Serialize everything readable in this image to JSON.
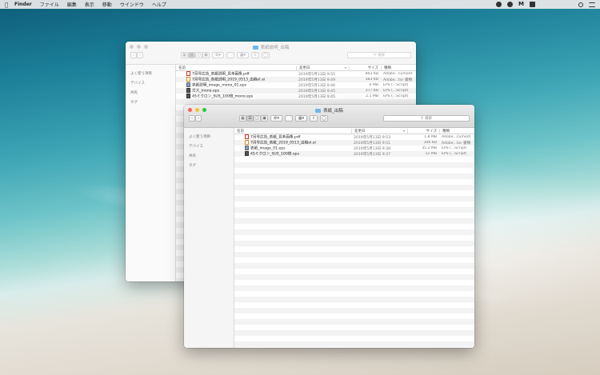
{
  "menubar": {
    "app": "Finder",
    "items": [
      "ファイル",
      "編集",
      "表示",
      "移動",
      "ウインドウ",
      "ヘルプ"
    ]
  },
  "back_window": {
    "title": "表紙説明_出稿",
    "search_placeholder": "検索",
    "sidebar": [
      "よく使う項目",
      "デバイス",
      "共有",
      "タグ"
    ],
    "columns": {
      "name": "名前",
      "date": "変更日",
      "size": "サイズ",
      "kind": "種類"
    },
    "files": [
      {
        "name": "7月号広告_表紙説明_見本画像.pdf",
        "date": "2019年5月13日 9:55",
        "size": "863 KB",
        "kind": "Adobe...cument",
        "icon": "pdf-file-icon"
      },
      {
        "name": "7月号広告_表紙説明_2019_0513_出稿ol.ai",
        "date": "2019年5月13日 9:49",
        "size": "383 KB",
        "kind": "Adobe...tor 書類",
        "icon": "ai-file-icon"
      },
      {
        "name": "表紙説明_image_mono_01.eps",
        "date": "2019年5月13日 9:46",
        "size": "6 MB",
        "kind": "EPS (...Script)",
        "icon": "eps-image-icon"
      },
      {
        "name": "ガス_mono.eps",
        "date": "2019年5月13日 9:45",
        "size": "377 KB",
        "kind": "EPS (...Script)",
        "icon": "eps-file-icon"
      },
      {
        "name": "45ミクロン_SUS_100倍_mono.eps",
        "date": "2019年5月13日 9:45",
        "size": "2.1 MB",
        "kind": "EPS (...Script)",
        "icon": "eps-file-icon"
      }
    ]
  },
  "front_window": {
    "title": "表紙_出稿",
    "search_placeholder": "検索",
    "sidebar": [
      "よく使う項目",
      "デバイス",
      "共有",
      "タグ"
    ],
    "columns": {
      "name": "名前",
      "date": "変更日",
      "size": "サイズ",
      "kind": "種類"
    },
    "files": [
      {
        "name": "7月号広告_表紙_見本画像.pdf",
        "date": "2019年5月13日 9:53",
        "size": "1.8 MB",
        "kind": "Adobe...cument",
        "icon": "pdf-file-icon"
      },
      {
        "name": "7月号広告_表紙_2019_0513_出稿ol.ai",
        "date": "2019年5月13日 9:51",
        "size": "346 KB",
        "kind": "Adobe...tor 書類",
        "icon": "ai-file-icon"
      },
      {
        "name": "表紙_image_01.eps",
        "date": "2019年5月13日 9:38",
        "size": "35.2 MB",
        "kind": "EPS (...Script)",
        "icon": "eps-image-icon"
      },
      {
        "name": "45ミクロン_SUS_100倍.eps",
        "date": "2019年5月13日 9:37",
        "size": "11 MB",
        "kind": "EPS (...Script)",
        "icon": "eps-file-icon"
      }
    ]
  }
}
